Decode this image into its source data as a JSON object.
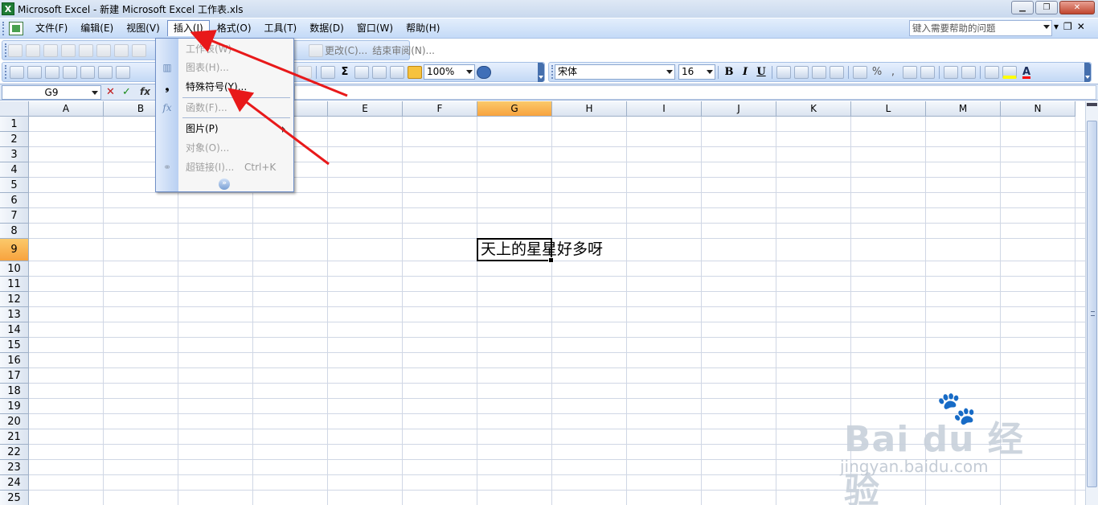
{
  "window": {
    "app_icon": "excel-icon",
    "title": "Microsoft Excel - 新建 Microsoft Excel 工作表.xls",
    "min_glyph": "▁",
    "max_glyph": "❐",
    "close_glyph": "✕"
  },
  "menubar": {
    "items": [
      "文件(F)",
      "编辑(E)",
      "视图(V)",
      "插入(I)",
      "格式(O)",
      "工具(T)",
      "数据(D)",
      "窗口(W)",
      "帮助(H)"
    ],
    "active_index": 3,
    "help_placeholder": "键入需要帮助的问题",
    "doc_min": "▾",
    "doc_restore": "❐",
    "doc_close": "✕"
  },
  "toolbar1": {
    "review_labels": [
      "更改(C)...",
      "结束审阅(N)..."
    ]
  },
  "toolbar2": {
    "zoom": "100%",
    "font_name": "宋体",
    "font_size": "16",
    "bold": "B",
    "italic": "I",
    "underline": "U",
    "sigma": "Σ",
    "percent": "%",
    "comma": ",",
    "font_color_letter": "A",
    "colors": {
      "fill_color": "#ffff00",
      "font_color": "#ff0000"
    }
  },
  "formula_bar": {
    "name_box": "G9",
    "cancel": "✕",
    "enter": "✓",
    "fx": "fx",
    "content": ""
  },
  "sheet": {
    "columns": [
      "A",
      "B",
      "C",
      "D",
      "E",
      "F",
      "G",
      "H",
      "I",
      "J",
      "K",
      "L",
      "M",
      "N"
    ],
    "rows": [
      "1",
      "2",
      "3",
      "4",
      "5",
      "6",
      "7",
      "8",
      "9",
      "10",
      "11",
      "12",
      "13",
      "14",
      "15",
      "16",
      "17",
      "18",
      "19",
      "20",
      "21",
      "22",
      "23",
      "24",
      "25"
    ],
    "selected_column": "G",
    "selected_row": "9",
    "active_cell": "G9",
    "cell_text": "天上的星星好多呀"
  },
  "insert_menu": {
    "items": [
      {
        "label": "工作表(W)",
        "enabled": false,
        "icon": "worksheet-icon"
      },
      {
        "label": "图表(H)...",
        "enabled": false,
        "icon": "chart-icon"
      },
      {
        "label": "特殊符号(Y)...",
        "enabled": true,
        "icon": "symbol-icon"
      },
      {
        "label": "函数(F)...",
        "enabled": false,
        "icon": "function-icon"
      },
      {
        "label": "图片(P)",
        "enabled": true,
        "submenu": true
      },
      {
        "label": "对象(O)...",
        "enabled": false
      },
      {
        "label": "超链接(I)...",
        "enabled": false,
        "shortcut": "Ctrl+K",
        "icon": "hyperlink-icon"
      }
    ],
    "icon_glyphs": {
      "chart": "▥",
      "symbol": "❟",
      "function": "fx",
      "hyperlink": "⚭"
    },
    "expand_glyph": "»"
  },
  "watermark": {
    "brand": "Bai du 经验",
    "url": "jingyan.baidu.com"
  },
  "annotations": {
    "arrow_color": "#e8191a"
  }
}
